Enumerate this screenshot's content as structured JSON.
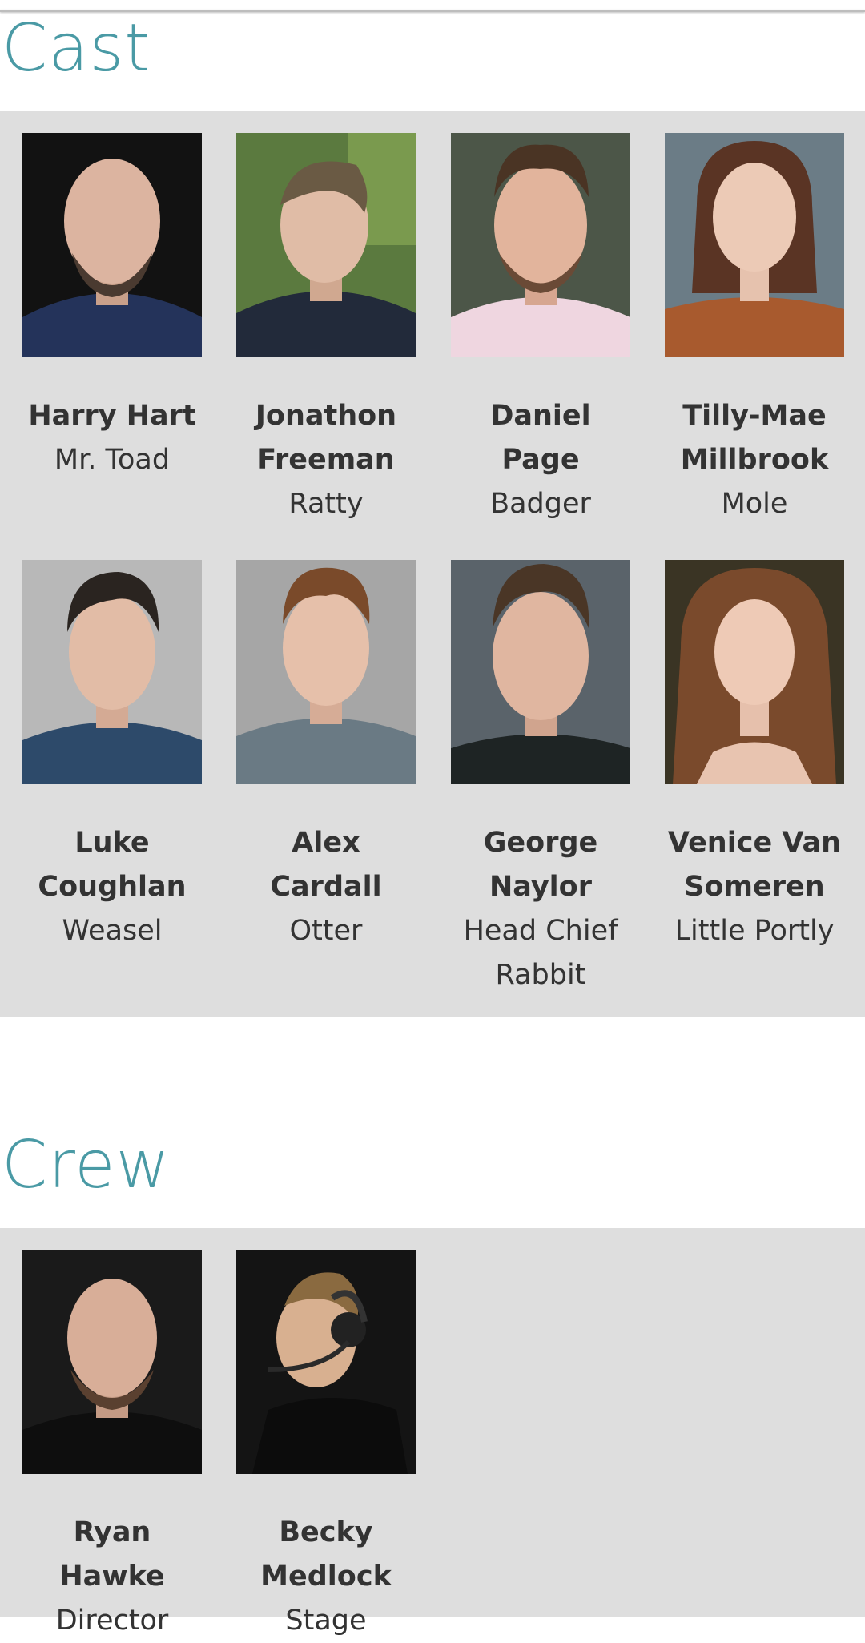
{
  "sections": {
    "cast": {
      "title": "Cast",
      "members": [
        {
          "name": "Harry Hart",
          "role": "Mr. Toad"
        },
        {
          "name": "Jonathon Freeman",
          "role": "Ratty"
        },
        {
          "name": "Daniel Page",
          "role": "Badger"
        },
        {
          "name": "Tilly-Mae Millbrook",
          "role": "Mole"
        },
        {
          "name": "Luke Coughlan",
          "role": "Weasel"
        },
        {
          "name": "Alex Cardall",
          "role": "Otter"
        },
        {
          "name": "George Naylor",
          "role": "Head Chief Rabbit"
        },
        {
          "name": "Venice Van Someren",
          "role": "Little Portly"
        }
      ]
    },
    "crew": {
      "title": "Crew",
      "members": [
        {
          "name": "Ryan Hawke",
          "role": "Director"
        },
        {
          "name": "Becky Medlock",
          "role": "Stage"
        }
      ]
    }
  },
  "colors": {
    "accent": "#4a9aa5",
    "panel_background": "#dedede",
    "text": "#333333"
  }
}
